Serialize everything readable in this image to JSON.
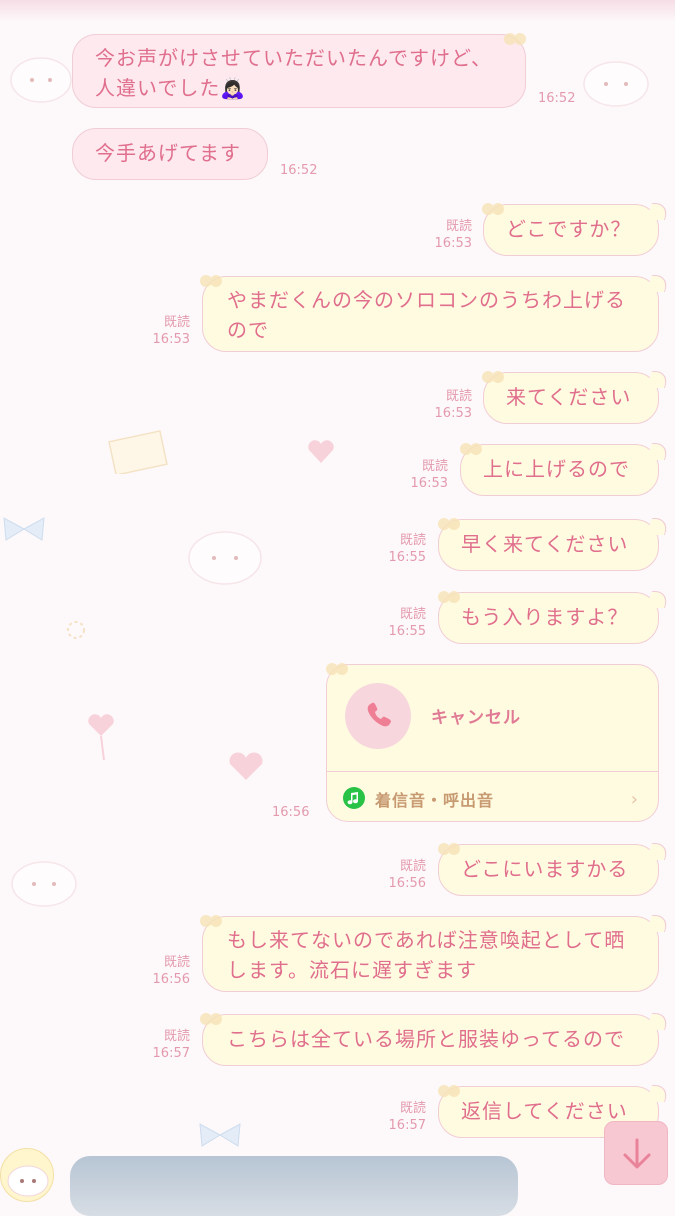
{
  "messages": [
    {
      "id": "m1",
      "side": "in",
      "text": "今お声がけさせていただいたんですけど、\n人違いでした🙇🏻‍♀️",
      "time": "16:52"
    },
    {
      "id": "m2",
      "side": "in",
      "text": "今手あげてます",
      "time": "16:52"
    },
    {
      "id": "m3",
      "side": "out",
      "text": "どこですか？",
      "read": "既読",
      "time": "16:53"
    },
    {
      "id": "m4",
      "side": "out",
      "text": "やまだくんの今のソロコンのうちわ上げる\nので",
      "read": "既読",
      "time": "16:53"
    },
    {
      "id": "m5",
      "side": "out",
      "text": "来てください",
      "read": "既読",
      "time": "16:53"
    },
    {
      "id": "m6",
      "side": "out",
      "text": "上に上げるので",
      "read": "既読",
      "time": "16:53"
    },
    {
      "id": "m7",
      "side": "out",
      "text": "早く来てください",
      "read": "既読",
      "time": "16:55"
    },
    {
      "id": "m8",
      "side": "out",
      "text": "もう入りますよ？",
      "read": "既読",
      "time": "16:55"
    },
    {
      "id": "m10",
      "side": "out",
      "text": "どこにいますかる",
      "read": "既読",
      "time": "16:56"
    },
    {
      "id": "m11",
      "side": "out",
      "text": "もし来てないのであれば注意喚起として晒\nします。流石に遅すぎます",
      "read": "既読",
      "time": "16:56"
    },
    {
      "id": "m12",
      "side": "out",
      "text": "こちらは全ている場所と服装ゆってるので",
      "read": "既読",
      "time": "16:57"
    },
    {
      "id": "m13",
      "side": "out",
      "text": "返信してください",
      "read": "既読",
      "time": "16:57"
    }
  ],
  "call": {
    "label": "キャンセル",
    "ringtone": "着信音・呼出音",
    "time": "16:56"
  },
  "colors": {
    "accent": "#e06e8d",
    "bubble_in": "#fde9ee",
    "bubble_out": "#fffbe0",
    "line_green": "#28c246"
  },
  "icons": {
    "call": "phone-icon",
    "ringtone": "music-note-icon",
    "scroll_down": "arrow-down-icon"
  }
}
